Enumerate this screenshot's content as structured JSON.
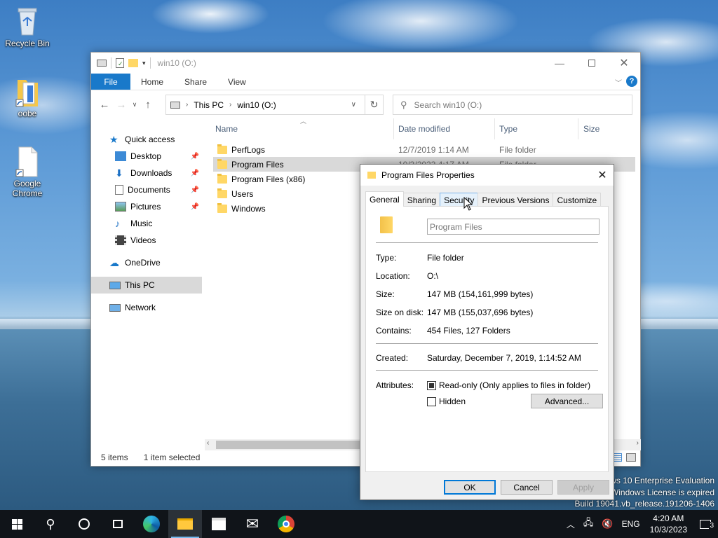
{
  "desktop": {
    "icons": [
      {
        "label": "Recycle Bin"
      },
      {
        "label": "oobe"
      },
      {
        "label": "Google Chrome"
      }
    ],
    "watermark": {
      "line1": "ows 10 Enterprise Evaluation",
      "line2": "Windows License is expired",
      "line3": "Build 19041.vb_release.191206-1406"
    }
  },
  "explorer": {
    "title": "win10 (O:)",
    "ribbon_tabs": [
      "File",
      "Home",
      "Share",
      "View"
    ],
    "help_label": "?",
    "breadcrumb": [
      "This PC",
      "win10 (O:)"
    ],
    "search_placeholder": "Search win10 (O:)",
    "nav": {
      "quick_access": "Quick access",
      "items": [
        {
          "label": "Desktop",
          "pinned": true
        },
        {
          "label": "Downloads",
          "pinned": true
        },
        {
          "label": "Documents",
          "pinned": true
        },
        {
          "label": "Pictures",
          "pinned": true
        },
        {
          "label": "Music",
          "pinned": false
        },
        {
          "label": "Videos",
          "pinned": false
        }
      ],
      "onedrive": "OneDrive",
      "this_pc": "This PC",
      "network": "Network"
    },
    "columns": [
      "Name",
      "Date modified",
      "Type",
      "Size"
    ],
    "files": [
      {
        "name": "PerfLogs",
        "date": "12/7/2019 1:14 AM",
        "type": "File folder"
      },
      {
        "name": "Program Files",
        "date": "10/3/2023 4:17 AM",
        "type": "File folder",
        "selected": true
      },
      {
        "name": "Program Files (x86)",
        "date": "",
        "type": ""
      },
      {
        "name": "Users",
        "date": "",
        "type": ""
      },
      {
        "name": "Windows",
        "date": "",
        "type": ""
      }
    ],
    "status": {
      "count": "5 items",
      "selection": "1 item selected"
    }
  },
  "dialog": {
    "title": "Program Files Properties",
    "tabs": [
      "General",
      "Sharing",
      "Security",
      "Previous Versions",
      "Customize"
    ],
    "active_tab": "General",
    "name_value": "Program Files",
    "props": [
      {
        "label": "Type:",
        "value": "File folder"
      },
      {
        "label": "Location:",
        "value": "O:\\"
      },
      {
        "label": "Size:",
        "value": "147 MB (154,161,999 bytes)"
      },
      {
        "label": "Size on disk:",
        "value": "147 MB (155,037,696 bytes)"
      },
      {
        "label": "Contains:",
        "value": "454 Files, 127 Folders"
      }
    ],
    "created_label": "Created:",
    "created_value": "Saturday, December 7, 2019, 1:14:52 AM",
    "attributes_label": "Attributes:",
    "readonly_label": "Read-only (Only applies to files in folder)",
    "readonly_checked": "indeterminate",
    "hidden_label": "Hidden",
    "hidden_checked": false,
    "advanced_label": "Advanced...",
    "ok_label": "OK",
    "cancel_label": "Cancel",
    "apply_label": "Apply"
  },
  "taskbar": {
    "lang": "ENG",
    "time": "4:20 AM",
    "date": "10/3/2023",
    "notification_count": "3"
  },
  "colors": {
    "accent": "#1979ca",
    "taskbar": "#101419",
    "selection": "#d9d9d9",
    "default_button_border": "#0078d7"
  }
}
